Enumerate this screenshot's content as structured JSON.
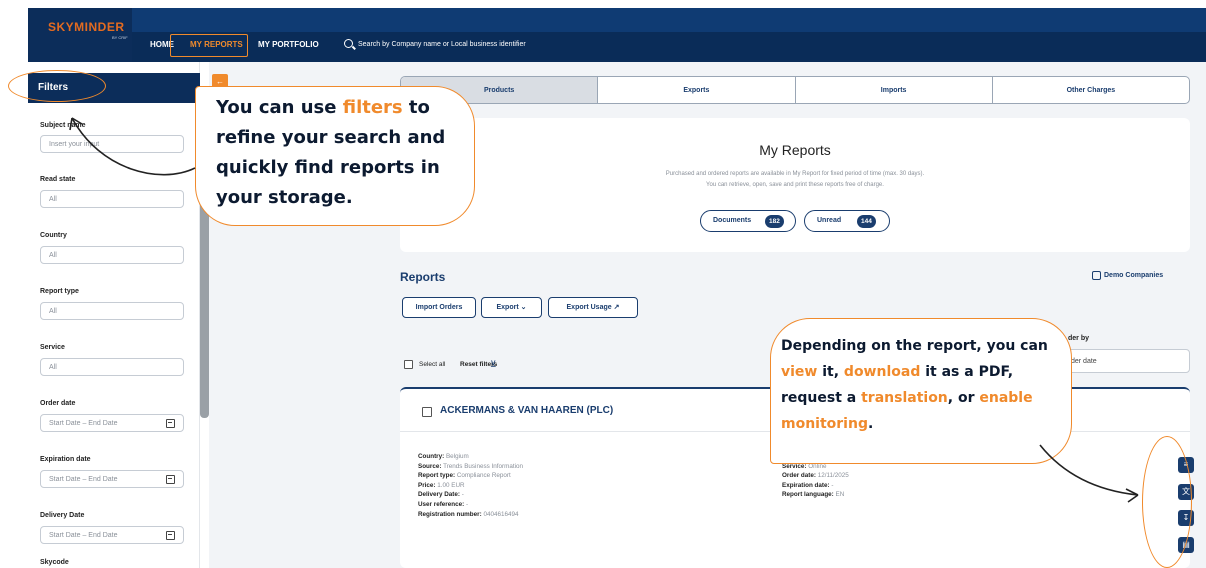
{
  "topbar": {
    "brand": "SKYMINDER",
    "brand_sub": "BY CRIF",
    "nav": {
      "home": "HOME",
      "reports": "MY REPORTS",
      "portfolio": "MY PORTFOLIO"
    },
    "search_placeholder": "Search by Company name or Local business identifier",
    "colors": {
      "navy": "#0a2c58",
      "accent": "#f08a2c"
    }
  },
  "sidebar": {
    "title": "Filters",
    "fields": [
      {
        "label": "Subject name",
        "value": "Insert your input"
      },
      {
        "label": "Read state",
        "value": "All"
      },
      {
        "label": "Country",
        "value": "All"
      },
      {
        "label": "Report type",
        "value": "All"
      },
      {
        "label": "Service",
        "value": "All"
      },
      {
        "label": "Order date",
        "value": "Start Date – End Date"
      },
      {
        "label": "Expiration date",
        "value": "Start Date – End Date"
      },
      {
        "label": "Delivery Date",
        "value": "Start Date – End Date"
      },
      {
        "label": "Skycode",
        "value": ""
      }
    ]
  },
  "tabs": [
    "Products",
    "Exports",
    "Imports",
    "Other Charges"
  ],
  "my_reports": {
    "title": "My Reports",
    "line1": "Purchased and ordered reports are available in My Report for fixed period of time (max. 30 days).",
    "line2": "You can retrieve, open, save and print these reports free of charge.",
    "documents_label": "Documents",
    "documents_count": "182",
    "unread_label": "Unread",
    "unread_count": "144"
  },
  "reports": {
    "heading": "Reports",
    "demo": "Demo Companies",
    "import_orders": "Import Orders",
    "export": "Export",
    "export_usage": "Export Usage",
    "order_by_label": "der by",
    "order_by_value": "der date",
    "select_all": "Select all",
    "reset_filters": "Reset filters"
  },
  "report_card": {
    "company": "ACKERMANS & VAN HAAREN (PLC)",
    "left": [
      {
        "k": "Country:",
        "v": "Belgium"
      },
      {
        "k": "Source:",
        "v": "Trends Business Information"
      },
      {
        "k": "Report type:",
        "v": "Compliance Report"
      },
      {
        "k": "Price:",
        "v": "1.00 EUR"
      },
      {
        "k": "Delivery Date:",
        "v": "-"
      },
      {
        "k": "User reference:",
        "v": "-"
      },
      {
        "k": "Registration number:",
        "v": "0404616494"
      }
    ],
    "right": [
      {
        "k": "Sk",
        "v": ""
      },
      {
        "k": "Service:",
        "v": "Online"
      },
      {
        "k": "Order date:",
        "v": "12/11/2025"
      },
      {
        "k": "Expiration date:",
        "v": "-"
      },
      {
        "k": "Report language:",
        "v": "EN"
      }
    ],
    "actions": [
      "view-icon",
      "translate-icon",
      "download-icon",
      "monitor-icon"
    ]
  },
  "callouts": {
    "filters": {
      "pre": "You can use ",
      "hl": "filters",
      "post": " to refine your search and quickly find reports in your storage."
    },
    "actions": {
      "a": "Depending on the report, you can ",
      "view": "view",
      "b": " it, ",
      "download": "download",
      "c": " it as a PDF, request a ",
      "translation": "translation",
      "d": ", or ",
      "monitoring": "enable monitoring",
      "e": "."
    }
  }
}
